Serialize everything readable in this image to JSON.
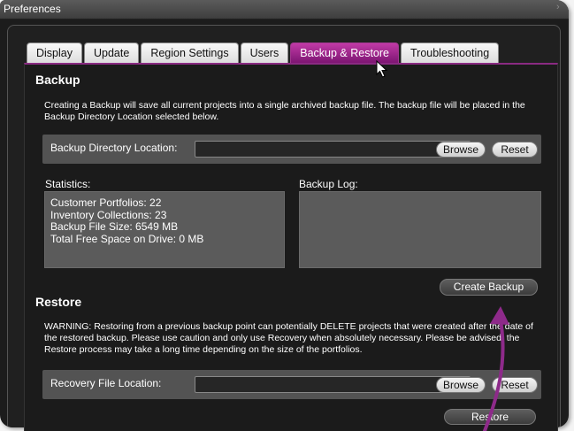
{
  "window": {
    "title": "Preferences"
  },
  "tabs": [
    {
      "label": "Display",
      "active": false
    },
    {
      "label": "Update",
      "active": false
    },
    {
      "label": "Region Settings",
      "active": false
    },
    {
      "label": "Users",
      "active": false
    },
    {
      "label": "Backup & Restore",
      "active": true
    },
    {
      "label": "Troubleshooting",
      "active": false
    }
  ],
  "backup": {
    "heading": "Backup",
    "description": "Creating a Backup will save all current projects into a single archived backup file. The backup file will be placed in the Backup Directory Location selected below.",
    "directory_label": "Backup Directory Location:",
    "directory_value": "",
    "browse_label": "Browse",
    "reset_label": "Reset",
    "statistics_label": "Statistics:",
    "statistics": [
      "Customer Portfolios: 22",
      "Inventory Collections: 23",
      "Backup File Size: 6549 MB",
      "Total Free Space on Drive: 0 MB"
    ],
    "log_label": "Backup Log:",
    "create_label": "Create Backup"
  },
  "restore": {
    "heading": "Restore",
    "warning": "WARNING: Restoring from a previous backup point can potentially DELETE projects that were created after the date of the restored backup. Please use caution and only use Recovery when absolutely necessary. Please be advised, the Restore process may take a long time depending on the size of the portfolios.",
    "file_label": "Recovery File Location:",
    "file_value": "",
    "browse_label": "Browse",
    "reset_label": "Reset",
    "restore_label": "Restore"
  },
  "colors": {
    "accent": "#9c2a8e",
    "annotation_arrow": "#8e2a8a"
  },
  "icons": {
    "cursor": "mouse-pointer-icon",
    "annotation": "curved-arrow-icon"
  }
}
